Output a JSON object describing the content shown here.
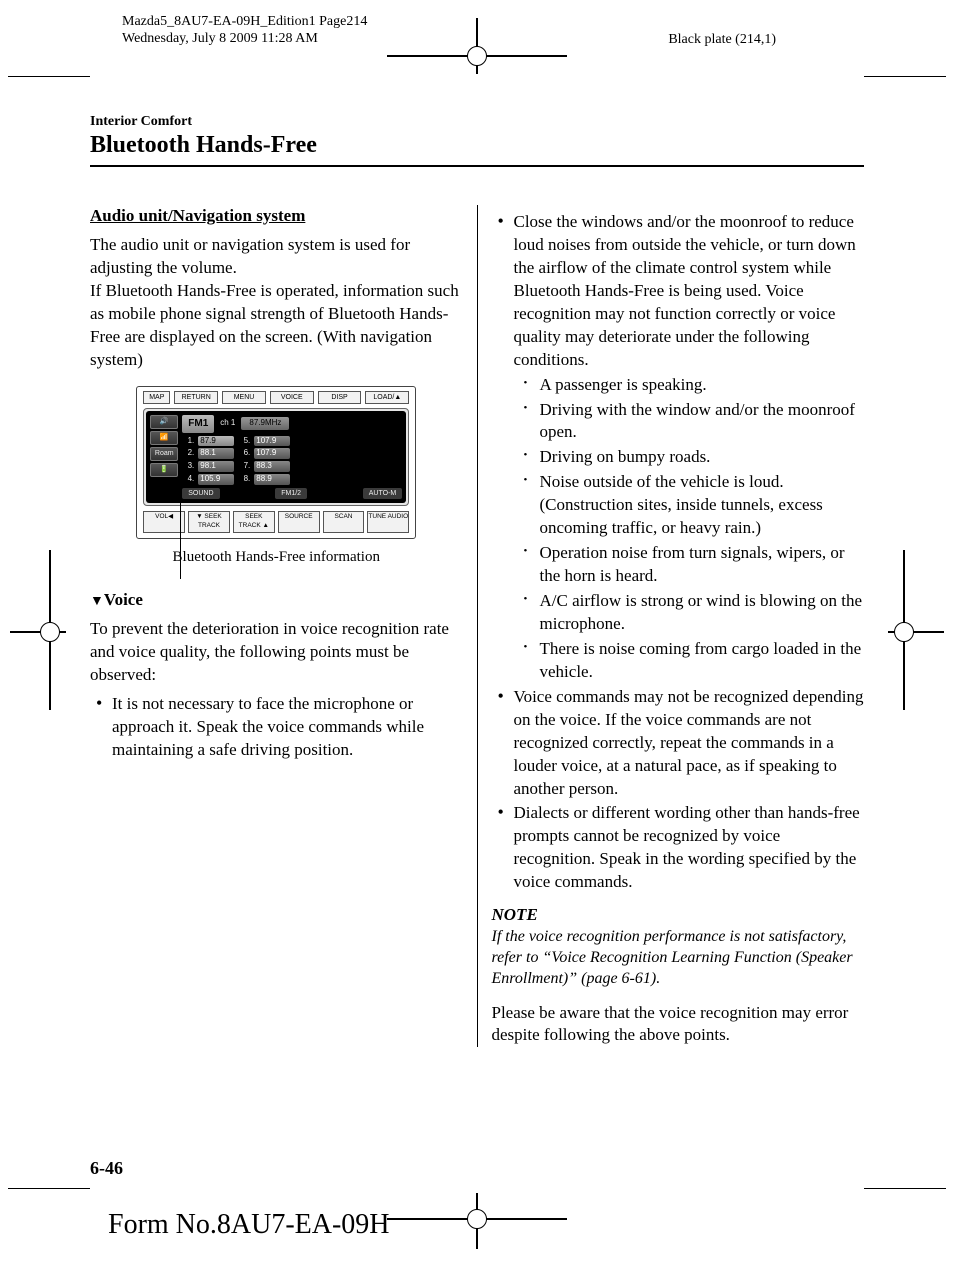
{
  "meta": {
    "doc_id_line": "Mazda5_8AU7-EA-09H_Edition1 Page214",
    "date_line": "Wednesday, July 8 2009 11:28 AM",
    "plate": "Black plate (214,1)"
  },
  "header": {
    "small": "Interior Comfort",
    "large": "Bluetooth Hands-Free"
  },
  "left": {
    "subhead": "Audio unit/Navigation system",
    "para": "The audio unit or navigation system is used for adjusting the volume.\nIf Bluetooth Hands-Free is operated, information such as mobile phone signal strength of Bluetooth Hands-Free are displayed on the screen. (With navigation system)",
    "fig_caption": "Bluetooth Hands-Free information",
    "voice_head": "Voice",
    "voice_intro": "To prevent the deterioration in voice recognition rate and voice quality, the following points must be observed:",
    "voice_bullet1": "It is not necessary to face the microphone or approach it. Speak the voice commands while maintaining a safe driving position."
  },
  "radio": {
    "top_buttons": [
      "MAP",
      "RETURN",
      "MENU",
      "VOICE",
      "DISP",
      "LOAD/▲"
    ],
    "band": "FM1",
    "ch": "ch  1",
    "freq": "87.9MHz",
    "presets": [
      {
        "n": "1.",
        "v": "87.9"
      },
      {
        "n": "5.",
        "v": "107.9"
      },
      {
        "n": "2.",
        "v": "88.1"
      },
      {
        "n": "6.",
        "v": "107.9"
      },
      {
        "n": "3.",
        "v": "98.1"
      },
      {
        "n": "7.",
        "v": "88.3"
      },
      {
        "n": "4.",
        "v": "105.9"
      },
      {
        "n": "8.",
        "v": "88.9"
      }
    ],
    "sound_row": {
      "left": "SOUND",
      "mid": "FM1/2",
      "right": "AUTO-M"
    },
    "bottom_buttons": [
      "VOL◀",
      "▼ SEEK TRACK",
      "SEEK TRACK ▲",
      "SOURCE",
      "SCAN",
      "TUNE AUDIO"
    ],
    "side_icons": [
      "🔊",
      "📶",
      "Roam",
      "🔋"
    ]
  },
  "right": {
    "bullet_close": "Close the windows and/or the moonroof to reduce loud noises from outside the vehicle, or turn down the airflow of the climate control system while Bluetooth Hands-Free is being used. Voice recognition may not function correctly or voice quality may deteriorate under the following conditions.",
    "sub": [
      "A passenger is speaking.",
      "Driving with the window and/or the moonroof open.",
      "Driving on bumpy roads.",
      "Noise outside of the vehicle is loud. (Construction sites, inside tunnels, excess oncoming traffic, or heavy rain.)",
      "Operation noise from turn signals, wipers, or the horn is heard.",
      "A/C airflow is strong or wind is blowing on the microphone.",
      "There is noise coming from cargo loaded in the vehicle."
    ],
    "bullet_voice": "Voice commands may not be recognized depending on the voice. If the voice commands are not recognized correctly, repeat the commands in a louder voice, at a natural pace, as if speaking to another person.",
    "bullet_dialect": "Dialects or different wording other than hands-free prompts cannot be recognized by voice recognition. Speak in the wording specified by the voice commands.",
    "note_head": "NOTE",
    "note_body": "If the voice recognition performance is not satisfactory, refer to “Voice Recognition Learning Function (Speaker Enrollment)” (page 6-61).",
    "closing": "Please be aware that the voice recognition may error despite following the above points."
  },
  "footer": {
    "page": "6-46",
    "form": "Form No.8AU7-EA-09H"
  }
}
